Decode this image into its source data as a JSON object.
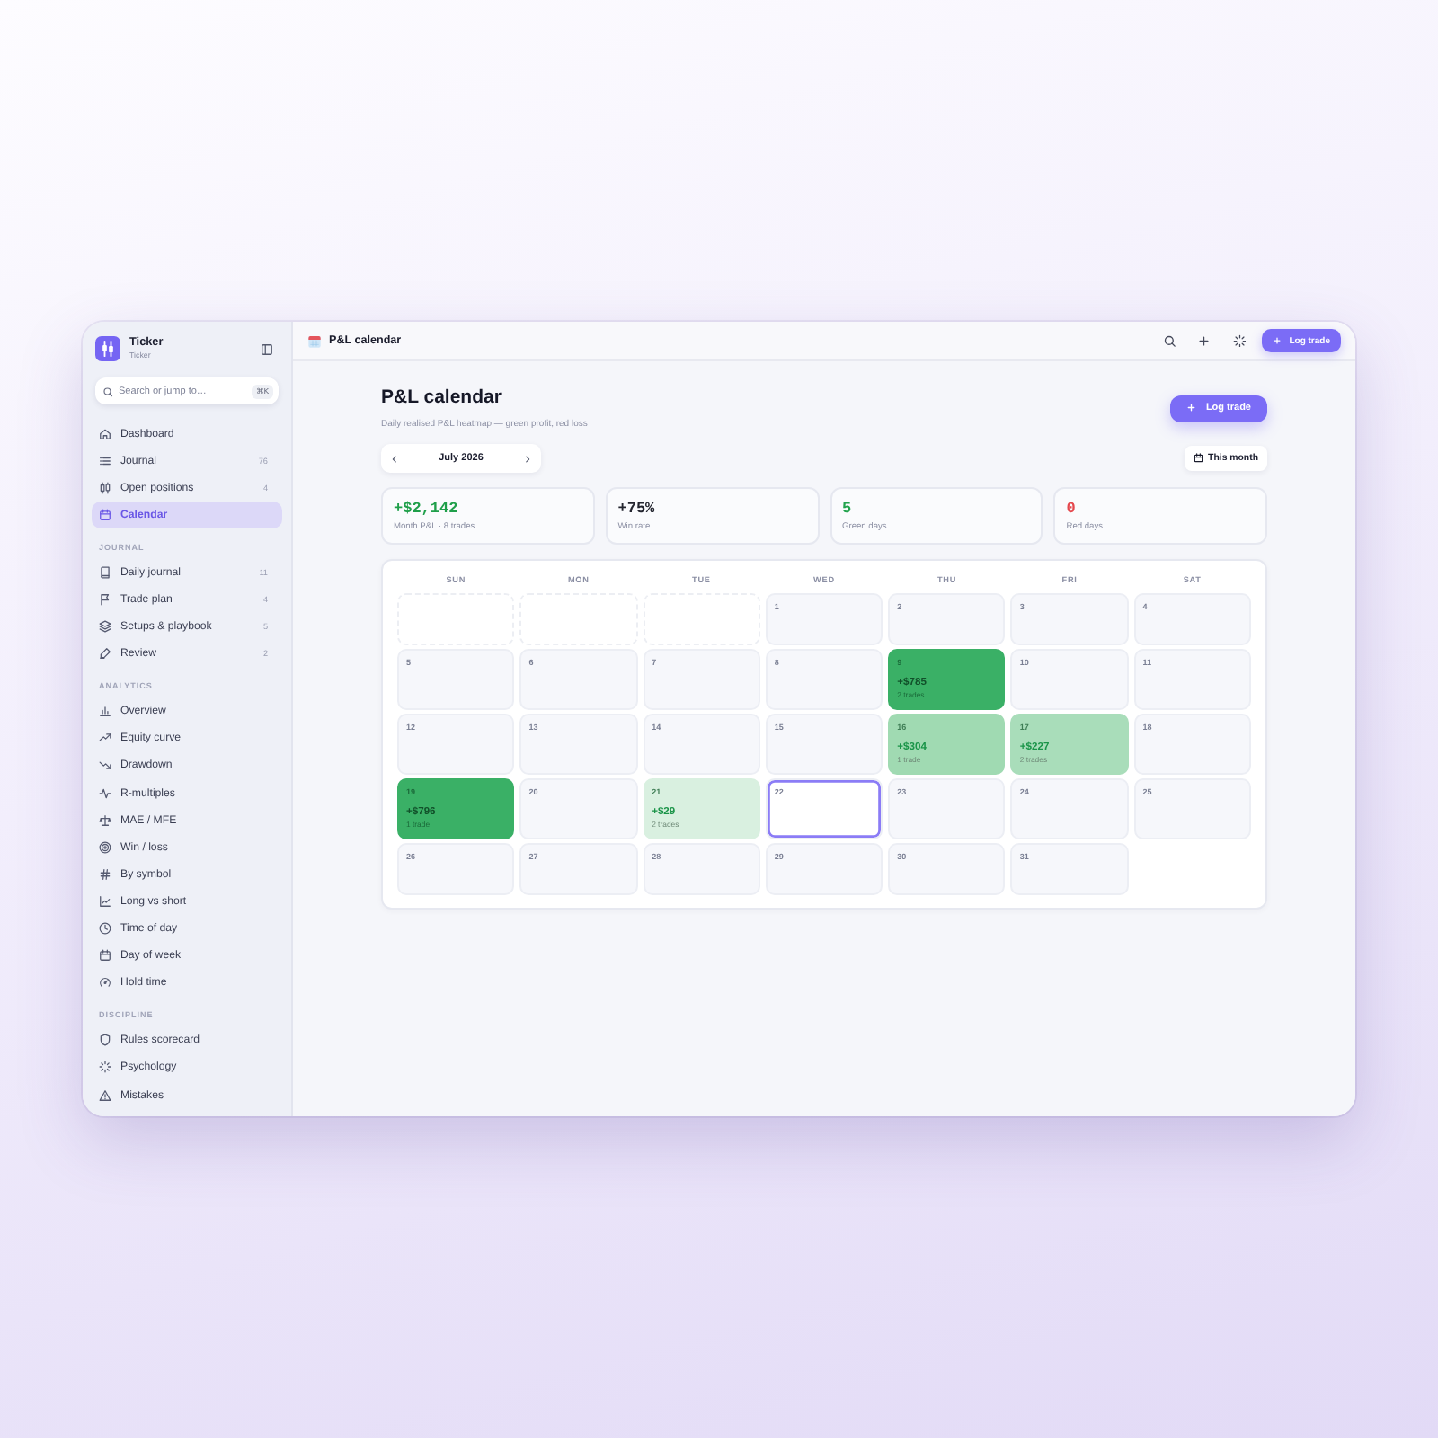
{
  "sidebar": {
    "brand": {
      "name": "Ticker",
      "subtitle": "Ticker"
    },
    "search": {
      "placeholder": "Search or jump to…",
      "shortcut": "⌘K"
    },
    "sections": [
      {
        "items": [
          {
            "label": "Dashboard",
            "selected": false
          },
          {
            "label": "Journal",
            "count": "76",
            "selected": false
          },
          {
            "label": "Open positions",
            "count": "4",
            "selected": false
          },
          {
            "label": "Calendar",
            "selected": true
          }
        ]
      },
      {
        "title": "JOURNAL",
        "items": [
          {
            "label": "Daily journal",
            "count": "11",
            "selected": false
          },
          {
            "label": "Trade plan",
            "count": "4",
            "selected": false
          },
          {
            "label": "Setups & playbook",
            "count": "5",
            "selected": false
          },
          {
            "label": "Review",
            "count": "2",
            "selected": false
          }
        ]
      },
      {
        "title": "ANALYTICS",
        "items": [
          {
            "label": "Overview",
            "selected": false
          },
          {
            "label": "Equity curve",
            "selected": false
          },
          {
            "label": "Drawdown",
            "selected": false
          },
          {
            "label": "R-multiples",
            "selected": false
          },
          {
            "label": "MAE / MFE",
            "selected": false
          },
          {
            "label": "Win / loss",
            "selected": false
          },
          {
            "label": "By symbol",
            "selected": false
          },
          {
            "label": "Long vs short",
            "selected": false
          },
          {
            "label": "Time of day",
            "selected": false
          },
          {
            "label": "Day of week",
            "selected": false
          },
          {
            "label": "Hold time",
            "selected": false
          }
        ]
      },
      {
        "title": "DISCIPLINE",
        "items": [
          {
            "label": "Rules scorecard",
            "selected": false
          },
          {
            "label": "Psychology",
            "selected": false
          },
          {
            "label": "Mistakes",
            "selected": false
          }
        ]
      }
    ]
  },
  "topbar": {
    "title": "P&L calendar",
    "action": "Log trade"
  },
  "header": {
    "title": "P&L calendar",
    "subtitle": "Daily realised P&L heatmap — green profit, red loss",
    "action": "Log trade"
  },
  "month_nav": {
    "month": "July 2026",
    "today_button": "This month"
  },
  "stats": [
    {
      "value": "+$2,142",
      "label": "Month P&L · 8 trades",
      "color": "#1f9f4a"
    },
    {
      "value": "+75%",
      "label": "Win rate",
      "color": "#23252f"
    },
    {
      "value": "5",
      "label": "Green days",
      "color": "#22a34d"
    },
    {
      "value": "0",
      "label": "Red days",
      "color": "#e5484d"
    }
  ],
  "calendar": {
    "weekdays": [
      "SUN",
      "MON",
      "TUE",
      "WED",
      "THU",
      "FRI",
      "SAT"
    ],
    "cells": [
      {
        "kind": "blank"
      },
      {
        "kind": "blank"
      },
      {
        "kind": "blank"
      },
      {
        "kind": "day",
        "day": "1",
        "today": false
      },
      {
        "kind": "day",
        "day": "2",
        "today": false
      },
      {
        "kind": "day",
        "day": "3",
        "today": false
      },
      {
        "kind": "day",
        "day": "4",
        "today": false
      },
      {
        "kind": "day",
        "day": "5",
        "today": false
      },
      {
        "kind": "day",
        "day": "6",
        "today": false
      },
      {
        "kind": "day",
        "day": "7",
        "today": false
      },
      {
        "kind": "day",
        "day": "8",
        "today": false
      },
      {
        "kind": "day",
        "day": "9",
        "pnl": "+$785",
        "trades": "2 trades",
        "color": "#3ab066",
        "today": false
      },
      {
        "kind": "day",
        "day": "10",
        "today": false
      },
      {
        "kind": "day",
        "day": "11",
        "today": false
      },
      {
        "kind": "day",
        "day": "12",
        "today": false
      },
      {
        "kind": "day",
        "day": "13",
        "today": false
      },
      {
        "kind": "day",
        "day": "14",
        "today": false
      },
      {
        "kind": "day",
        "day": "15",
        "today": false
      },
      {
        "kind": "day",
        "day": "16",
        "pnl": "+$304",
        "trades": "1 trade",
        "color": "#a0dab2",
        "today": false
      },
      {
        "kind": "day",
        "day": "17",
        "pnl": "+$227",
        "trades": "2 trades",
        "color": "#a9ddba",
        "today": false
      },
      {
        "kind": "day",
        "day": "18",
        "today": false
      },
      {
        "kind": "day",
        "day": "19",
        "pnl": "+$796",
        "trades": "1 trade",
        "color": "#3ab066",
        "today": false
      },
      {
        "kind": "day",
        "day": "20",
        "today": false
      },
      {
        "kind": "day",
        "day": "21",
        "pnl": "+$29",
        "trades": "2 trades",
        "color": "#d9f0e0",
        "today": false
      },
      {
        "kind": "day",
        "day": "22",
        "today": true
      },
      {
        "kind": "day",
        "day": "23",
        "today": false
      },
      {
        "kind": "day",
        "day": "24",
        "today": false
      },
      {
        "kind": "day",
        "day": "25",
        "today": false
      },
      {
        "kind": "day",
        "day": "26",
        "today": false
      },
      {
        "kind": "day",
        "day": "27",
        "today": false
      },
      {
        "kind": "day",
        "day": "28",
        "today": false
      },
      {
        "kind": "day",
        "day": "29",
        "today": false
      },
      {
        "kind": "day",
        "day": "30",
        "today": false
      },
      {
        "kind": "day",
        "day": "31",
        "today": false
      }
    ]
  }
}
